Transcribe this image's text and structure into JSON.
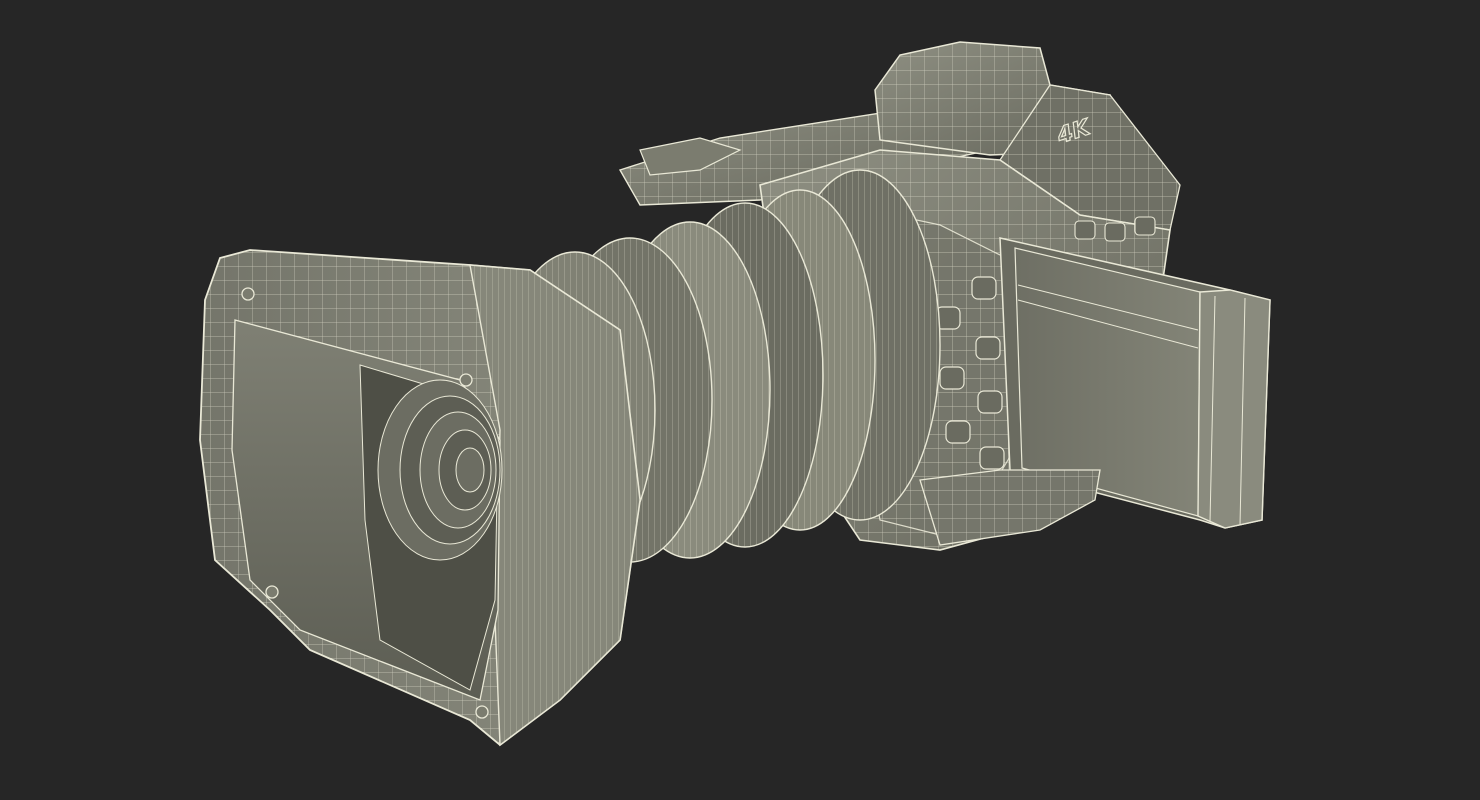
{
  "scene": {
    "subject": "camcorder-wireframe-model",
    "background_color": "#262626",
    "surface_color": "#7b7c6f",
    "surface_dark_color": "#5f6055",
    "surface_light_color": "#8e8f82",
    "wire_color": "#e9e8d6",
    "body_logo": "4K"
  }
}
